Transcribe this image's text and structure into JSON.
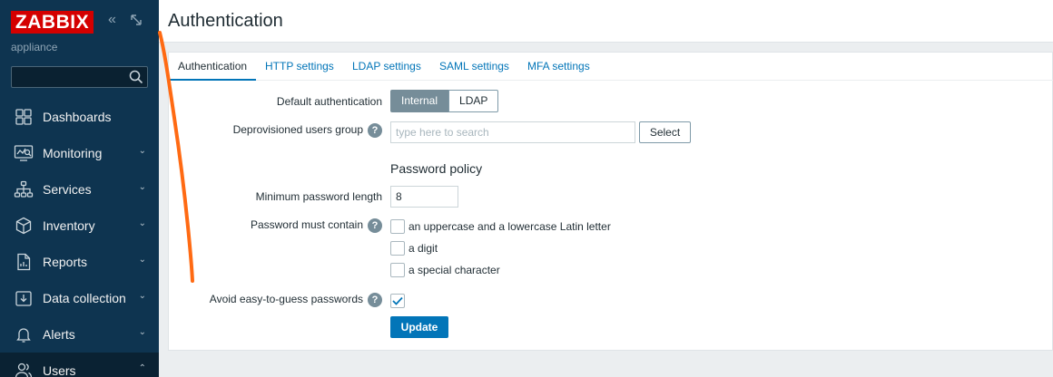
{
  "sidebar": {
    "logo": "ZABBIX",
    "subtitle": "appliance",
    "search": {
      "value": "",
      "placeholder": ""
    },
    "items": [
      {
        "label": "Dashboards",
        "icon": "dashboard-icon",
        "has_chevron": false
      },
      {
        "label": "Monitoring",
        "icon": "monitoring-icon",
        "chevron": "⌄"
      },
      {
        "label": "Services",
        "icon": "services-icon",
        "chevron": "⌄"
      },
      {
        "label": "Inventory",
        "icon": "inventory-icon",
        "chevron": "⌄"
      },
      {
        "label": "Reports",
        "icon": "reports-icon",
        "chevron": "⌄"
      },
      {
        "label": "Data collection",
        "icon": "data-collection-icon",
        "chevron": "⌄"
      },
      {
        "label": "Alerts",
        "icon": "bell-icon",
        "chevron": "⌄"
      },
      {
        "label": "Users",
        "icon": "users-icon",
        "chevron": "⌃",
        "active": true
      }
    ]
  },
  "header": {
    "title": "Authentication"
  },
  "tabs": [
    {
      "label": "Authentication",
      "active": true
    },
    {
      "label": "HTTP settings"
    },
    {
      "label": "LDAP settings"
    },
    {
      "label": "SAML settings"
    },
    {
      "label": "MFA settings"
    }
  ],
  "form": {
    "default_auth": {
      "label": "Default authentication",
      "options": [
        "Internal",
        "LDAP"
      ],
      "selected": "Internal"
    },
    "deprovisioned": {
      "label": "Deprovisioned users group",
      "help": "?",
      "placeholder": "type here to search",
      "select_label": "Select"
    },
    "password_policy": {
      "title": "Password policy",
      "min_length_label": "Minimum password length",
      "min_length_value": "8",
      "must_contain_label": "Password must contain",
      "help": "?",
      "options": [
        {
          "label": "an uppercase and a lowercase Latin letter",
          "checked": false
        },
        {
          "label": "a digit",
          "checked": false
        },
        {
          "label": "a special character",
          "checked": false
        }
      ],
      "avoid_label": "Avoid easy-to-guess passwords",
      "avoid_checked": true
    },
    "update_label": "Update"
  },
  "colors": {
    "sidebar_bg": "#0e3450",
    "logo_bg": "#d40000",
    "accent": "#0275b8",
    "annotation_stroke": "#ff6a13"
  }
}
